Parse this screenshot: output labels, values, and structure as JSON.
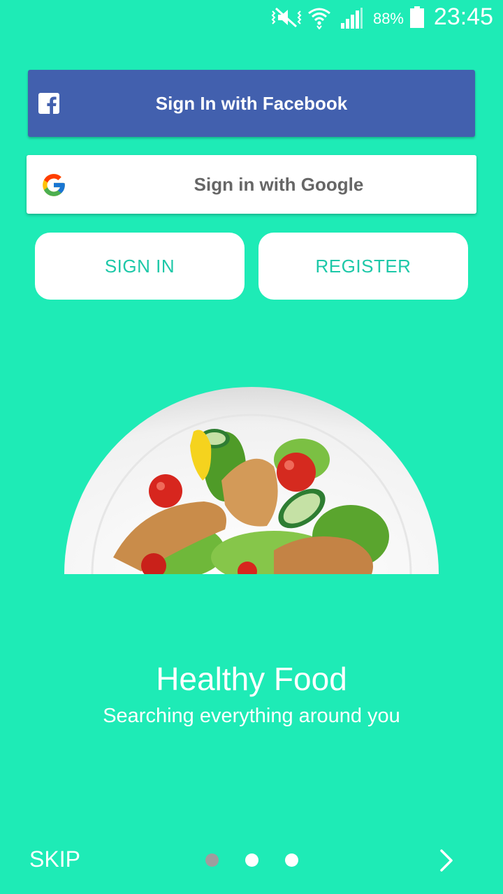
{
  "status_bar": {
    "battery": "88%",
    "time": "23:45"
  },
  "auth": {
    "facebook_label": "Sign In with Facebook",
    "google_label": "Sign in with Google",
    "sign_in_label": "SIGN IN",
    "register_label": "REGISTER"
  },
  "slide": {
    "title": "Healthy Food",
    "subtitle": "Searching everything around you",
    "illustration": "salad-plate"
  },
  "footer": {
    "skip_label": "SKIP",
    "pages": 3,
    "active_page": 1
  },
  "colors": {
    "background": "#1EEBB6",
    "facebook": "#4260AE",
    "accent_text": "#1DC8A8",
    "dot_active": "#9E9E9E"
  }
}
